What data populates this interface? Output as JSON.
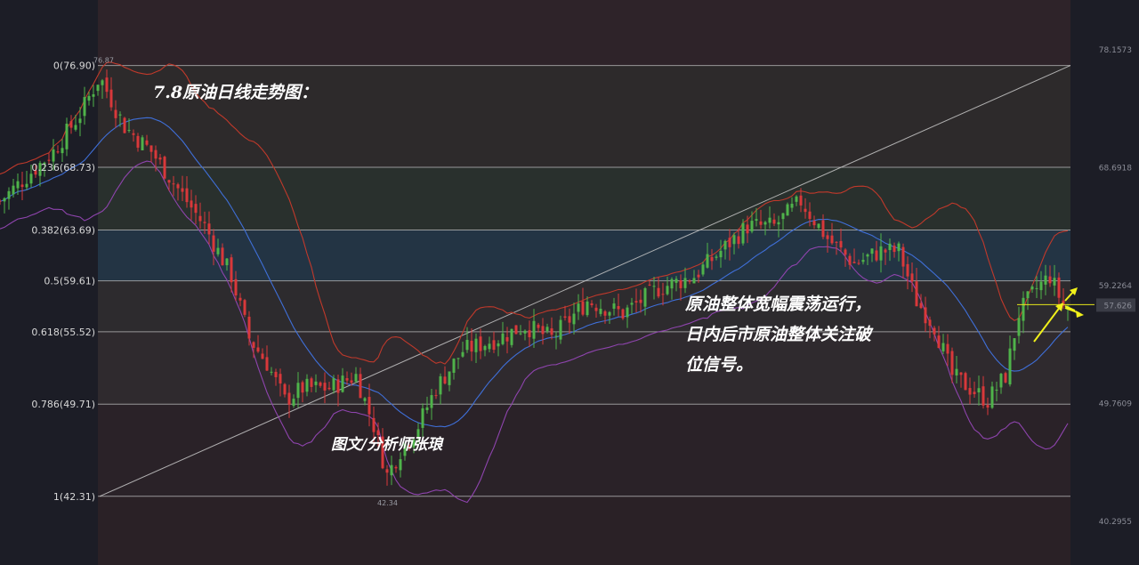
{
  "chart_data": {
    "type": "candlestick",
    "fib_levels": [
      {
        "ratio": "0",
        "price": 76.9,
        "label": "0(76.90)"
      },
      {
        "ratio": "0.236",
        "price": 68.73,
        "label": "0.236(68.73)"
      },
      {
        "ratio": "0.382",
        "price": 63.69,
        "label": "0.382(63.69)"
      },
      {
        "ratio": "0.5",
        "price": 59.61,
        "label": "0.5(59.61)"
      },
      {
        "ratio": "0.618",
        "price": 55.52,
        "label": "0.618(55.52)"
      },
      {
        "ratio": "0.786",
        "price": 49.71,
        "label": "0.786(49.71)"
      },
      {
        "ratio": "1",
        "price": 42.31,
        "label": "1(42.31)"
      }
    ],
    "axis_ticks": [
      "78.1573",
      "68.6918",
      "59.2264",
      "49.7609",
      "40.2955"
    ],
    "current_price": "57.626",
    "high_label": "76.87",
    "low_label": "42.34",
    "title": "7.8原油日线走势图：",
    "annotation_lines": [
      "原油整体宽幅震荡运行，",
      "日内后市原油整体关注破",
      "位信号。"
    ],
    "author": "图文/分析师张琅",
    "colors": {
      "up": "#4fb34a",
      "down": "#d9383a",
      "upper_band": "#c0392b",
      "mid_band": "#3f6fd8",
      "lower_band": "#8e44ad",
      "trend_line": "#c8c8c8",
      "arrow": "#f1f11a"
    }
  }
}
